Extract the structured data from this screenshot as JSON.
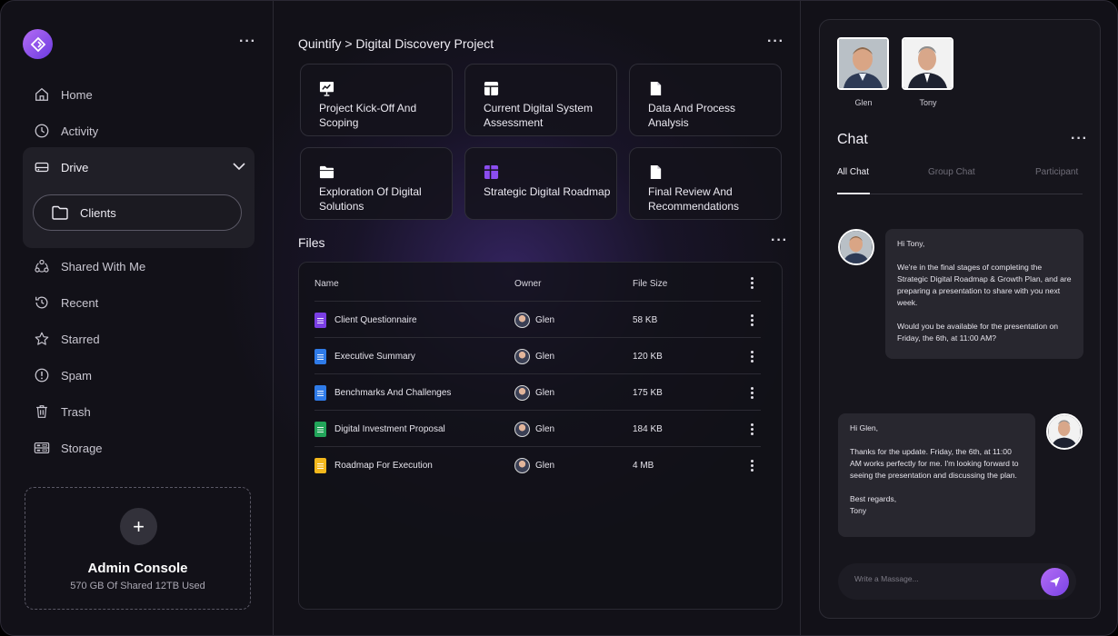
{
  "sidebar": {
    "nav": [
      {
        "label": "Home",
        "icon": "home-icon"
      },
      {
        "label": "Activity",
        "icon": "clock-icon"
      },
      {
        "label": "Shared With Me",
        "icon": "share-icon"
      },
      {
        "label": "Recent",
        "icon": "history-icon"
      },
      {
        "label": "Starred",
        "icon": "star-icon"
      },
      {
        "label": "Spam",
        "icon": "alert-icon"
      },
      {
        "label": "Trash",
        "icon": "trash-icon"
      },
      {
        "label": "Storage",
        "icon": "storage-icon"
      }
    ],
    "drive": {
      "label": "Drive",
      "icon": "drive-icon",
      "expanded": true,
      "children": [
        {
          "label": "Clients",
          "icon": "folder-icon"
        }
      ]
    },
    "admin": {
      "title": "Admin Console",
      "usage": "570 GB Of Shared 12TB Used"
    }
  },
  "main": {
    "breadcrumb": "Quintify > Digital Discovery Project",
    "cards": [
      {
        "label": "Project Kick-Off And Scoping",
        "icon": "presentation-icon"
      },
      {
        "label": "Current Digital System Assessment",
        "icon": "table-icon"
      },
      {
        "label": "Data And Process Analysis",
        "icon": "document-icon"
      },
      {
        "label": "Exploration Of Digital Solutions",
        "icon": "folder-icon"
      },
      {
        "label": "Strategic Digital Roadmap",
        "icon": "roadmap-icon"
      },
      {
        "label": "Final Review And Recommendations",
        "icon": "document-icon"
      }
    ],
    "files": {
      "title": "Files",
      "columns": {
        "name": "Name",
        "owner": "Owner",
        "size": "File Size"
      },
      "rows": [
        {
          "name": "Client Questionnaire",
          "owner": "Glen",
          "size": "58 KB",
          "type": "forms",
          "color": "#7b3fe4"
        },
        {
          "name": "Executive Summary",
          "owner": "Glen",
          "size": "120 KB",
          "type": "docs",
          "color": "#2f7be8"
        },
        {
          "name": "Benchmarks And Challenges",
          "owner": "Glen",
          "size": "175 KB",
          "type": "docs",
          "color": "#2f7be8"
        },
        {
          "name": "Digital Investment Proposal",
          "owner": "Glen",
          "size": "184 KB",
          "type": "sheets",
          "color": "#22a55a"
        },
        {
          "name": "Roadmap For Execution",
          "owner": "Glen",
          "size": "4 MB",
          "type": "slides",
          "color": "#f3b81c"
        }
      ]
    }
  },
  "chat": {
    "participants": [
      {
        "name": "Glen"
      },
      {
        "name": "Tony"
      }
    ],
    "title": "Chat",
    "tabs": [
      "All Chat",
      "Group Chat",
      "Participant"
    ],
    "active_tab": "All Chat",
    "messages": [
      {
        "from": "Glen",
        "text": "Hi Tony,\n\nWe're in the final stages of completing the Strategic Digital Roadmap & Growth Plan, and are preparing a presentation to share with you next week.\n\nWould you be available for the presentation on Friday, the 6th, at 11:00 AM?"
      },
      {
        "from": "Tony",
        "text": "Hi Glen,\n\nThanks for the update. Friday, the 6th, at 11:00 AM works perfectly for me. I'm looking forward to seeing the presentation and discussing the plan.\n\nBest regards,\nTony"
      }
    ],
    "input_placeholder": "Write a Massage..."
  },
  "colors": {
    "accent": "#8b4df0",
    "background": "#121118",
    "panel": "#16151c"
  }
}
